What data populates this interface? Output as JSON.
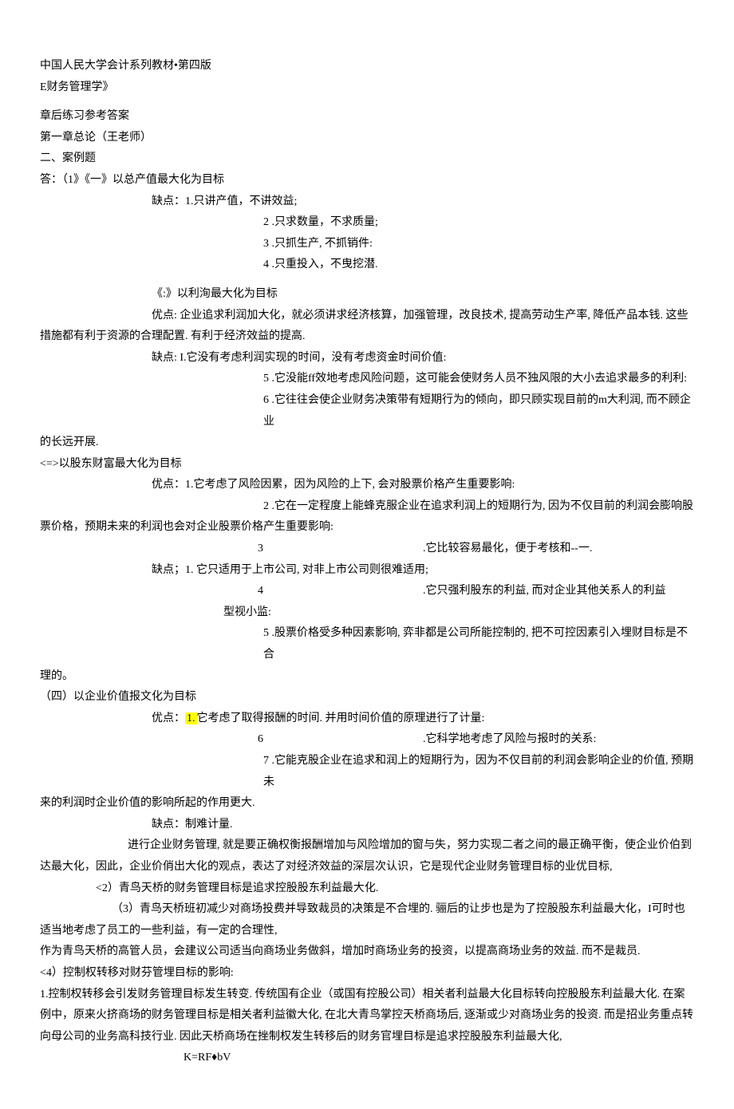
{
  "header": {
    "line1": "中国人民大学会计系列教材•第四版",
    "line2": "E财务管理学》"
  },
  "title": {
    "line1": "章后练习参考答案",
    "line2": "第一章总论（王老师）",
    "line3": "二、案例题",
    "line4": "答：（1》《一》以总产值最大化为目标"
  },
  "sec1": {
    "drawback_intro": "缺点：1.只讲产值，不讲效益;",
    "d2_num": "2",
    "d2_text": " .只求数量，不求质量;",
    "d3_num": "3",
    "d3_text": " .只抓生产, 不抓销件:",
    "d4_num": "4",
    "d4_text": " .只重投入，不曳挖潜."
  },
  "sec2": {
    "title": "《:》以利洵最大化为目标",
    "adv": "优点: 企业追求利润加大化，就必须讲求经济核算，加强管理，改良技术, 提高劳动生产率, 降低产品本钱. 这些措施都有利于资源的合理配置. 有利于经济效益的提高.",
    "d1": "缺点: I.它没有考虑利润实现的时间，没有考虑资金时间价值:",
    "d5_num": "5",
    "d5_text": " .它没能ff效地考虑风险问题，这可能会使财务人员不独风限的大小去追求最多的利利:",
    "d6_num": "6",
    "d6_text": " .它往往会使企业财务决策带有短期行为的倾向，即只顾实现目前的m大利润, 而不顾企业",
    "d6_cont": "的长远开展."
  },
  "sec3": {
    "title": "<=>以股东财富最大化为目标",
    "a1": "优点：1.它考虑了风险因累，因为风险的上下, 会对股票价格产生重要影响:",
    "a2_num": "2",
    "a2_text": " .它在一定程度上能蜂克服企业在追求利润上的短期行为, 因为不仅目前的利润会膨响股",
    "a2_cont": "票价格，预期未来的利润也会对企业股票价格产生重要影响:",
    "a3_num": "3",
    "a3_text": ".它比较容易最化，便于考核和--一.",
    "d1": "缺点；1. 它只适用于上市公司, 对非上市公司则很难适用;",
    "d4_num": "4",
    "d4_text": ".它只强利股东的利益, 而对企业其他关系人的利益",
    "d4_cont": "型视小监:",
    "d5_num": "5",
    "d5_text": " .股票价格受多种因素影响, 弈非都是公司所能控制的, 把不可控因素引入埋财目标是不合",
    "d5_cont": "理的。"
  },
  "sec4": {
    "title": "（四）以企业价值报文化为目标",
    "a1_pre": "优点：",
    "a1_hl": "1.",
    "a1_post": "它考虑了取得报酬的时间. 并用时间价值的原理进行了计量:",
    "a6_num": "6",
    "a6_text": ".它科学地考虑了风险与报时的关系:",
    "a7_num": "7",
    "a7_text": " .它能克股企业在追求和润上的短期行为，因为不仅目前的利润会影响企业的价值, 预期未",
    "a7_cont": "来的利润时企业价值的影响所起的作用更大.",
    "d1": "缺点：制难计量.",
    "para1": "进行企业财务管理, 就是要正确权衡报酬增加与风险增加的窗与失，努力实现二者之间的最正确平衡，使企业价伯到达最大化，因此，企业价俏出大化的观点，表达了对经济效益的深层次认识，它是现代企业财务管理目标的业优目标,"
  },
  "q2": "<2）青鸟天桥的财务管理目标是追求控股股东利益最大化.",
  "q3": {
    "text": "（3）青鸟天桥班初减少对商场投费并导致裁员的决策是不合埋的. 骊后的让步也是为了控股股东利益最大化，I可时也适当地考虑了员工的一些利益，有一定的合理性,",
    "text2": "作为青鸟天桥的高管人员，会建议公司适当向商场业务做斜，增加时商场业务的投资，以提高商场业务的效益. 而不是裁员."
  },
  "q4": {
    "title": "<4）控制权转移对财芬管埋目标的影响:",
    "p1": "1.控制权转移会引发财务管理目标发生转变. 传统国有企业（或国有控股公司）相关者利益最大化目标转向控股股东利益最大化. 在案例中，原来火挤商场的财务管理目标是相关者利益徽大化, 在北大青鸟掌控天桥商场后, 逐渐或少对商场业务的投资. 而是招业务重点转向母公司的业务高科技行业. 因此天桥商场在挫制权发生转移后的财务官埋目标是追求控股股东利益最大化,"
  },
  "formula": "K=RF♦bV"
}
